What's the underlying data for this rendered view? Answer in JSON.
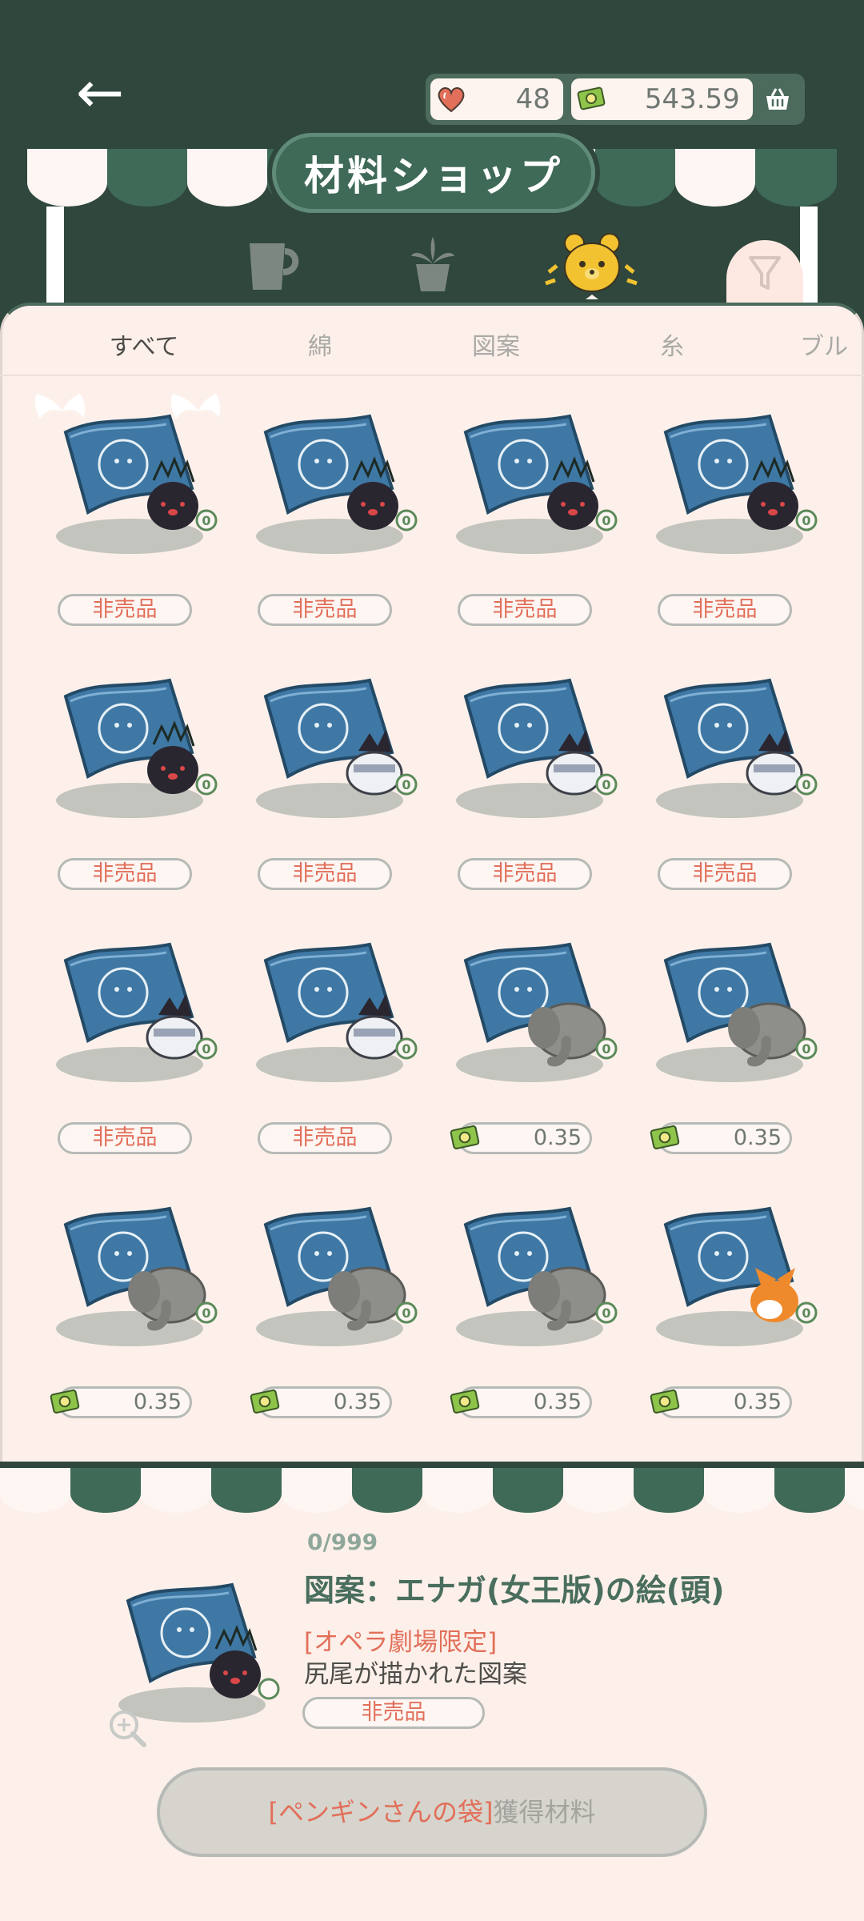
{
  "header": {
    "shop_title": "材料ショップ",
    "hearts": "48",
    "money": "543.59"
  },
  "category_icons": [
    "cup-icon",
    "plant-icon",
    "bear-icon"
  ],
  "subtabs": [
    "すべて",
    "綿",
    "図案",
    "糸",
    "ブル"
  ],
  "items": [
    {
      "creature": "crow",
      "price": "非売品"
    },
    {
      "creature": "crow",
      "price": "非売品"
    },
    {
      "creature": "crow",
      "price": "非売品"
    },
    {
      "creature": "crow",
      "price": "非売品"
    },
    {
      "creature": "crow",
      "price": "非売品"
    },
    {
      "creature": "penguin",
      "price": "非売品"
    },
    {
      "creature": "penguin",
      "price": "非売品"
    },
    {
      "creature": "penguin",
      "price": "非売品"
    },
    {
      "creature": "penguin",
      "price": "非売品"
    },
    {
      "creature": "penguin",
      "price": "非売品"
    },
    {
      "creature": "elephant",
      "price": "0.35"
    },
    {
      "creature": "elephant",
      "price": "0.35"
    },
    {
      "creature": "elephant",
      "price": "0.35"
    },
    {
      "creature": "elephant",
      "price": "0.35"
    },
    {
      "creature": "elephant",
      "price": "0.35"
    },
    {
      "creature": "corgi",
      "price": "0.35"
    }
  ],
  "item_count_badge": "0",
  "detail": {
    "count": "0/999",
    "title": "図案：エナガ(女王版)の絵(頭)",
    "tag": "[オペラ劇場限定]",
    "description": "尻尾が描かれた図案",
    "price": "非売品",
    "bag_button_highlight": "[ペンギンさんの袋]",
    "bag_button_suffix": "獲得材料"
  },
  "colors": {
    "dark_green": "#2f473d",
    "mid_green": "#4d6b5d",
    "salmon": "#e26f5a",
    "blueprint": "#3f78a4"
  }
}
